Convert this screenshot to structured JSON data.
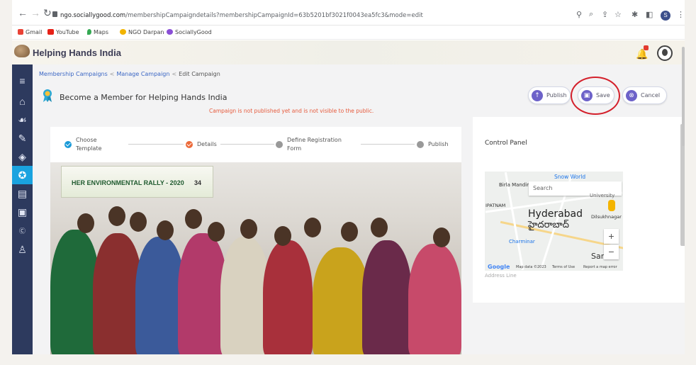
{
  "browser": {
    "url_host": "ngo.sociallygood.com",
    "url_path": "/membershipCampaigndetails?membershipCampaignId=63b5201bf3021f0043ea5fc3&mode=edit",
    "profile_initial": "S",
    "bookmarks": [
      "Gmail",
      "YouTube",
      "Maps",
      "NGO Darpan",
      "SociallyGood"
    ]
  },
  "app": {
    "brand": "Helping Hands India",
    "notification_count": "1"
  },
  "breadcrumb": {
    "item1": "Membership Campaigns",
    "item2": "Manage Campaign",
    "item3": "Edit Campaign"
  },
  "page": {
    "title": "Become a Member for Helping Hands India",
    "notice": "Campaign is not published yet and is not visible to the public."
  },
  "actions": {
    "publish": "Publish",
    "save": "Save",
    "cancel": "Cancel"
  },
  "stepper": {
    "steps": [
      "Choose Template",
      "Details",
      "Define Registration Form",
      "Publish"
    ],
    "step1_l1": "Choose",
    "step1_l2": "Template",
    "step2": "Details",
    "step3_l1": "Define Registration",
    "step3_l2": "Form",
    "step4": "Publish"
  },
  "photo": {
    "banner_text": "HER ENVIRONMENTAL RALLY - 2020",
    "banner_num": "34"
  },
  "control_panel": {
    "title": "Control Panel",
    "map_search_placeholder": "Search",
    "map_labels": {
      "snow_world": "Snow World",
      "birla": "Birla Mandir",
      "university": "University",
      "patnam": "IPATNAM",
      "hyderabad": "Hyderabad",
      "hyderabad_te": "హైదరాబాద్",
      "dilsukh": "Dilsukhnagar",
      "charminar": "Charminar",
      "saroor": "Sar",
      "map_data": "Map data ©2023",
      "terms": "Terms of Use",
      "report": "Report a map error"
    },
    "address_label": "Address Line"
  },
  "colors": {
    "sidebar": "#2d3a5e",
    "active": "#1aa3e0",
    "accent": "#6d62c9",
    "notice": "#e65a3c",
    "ring": "#d4202b"
  }
}
